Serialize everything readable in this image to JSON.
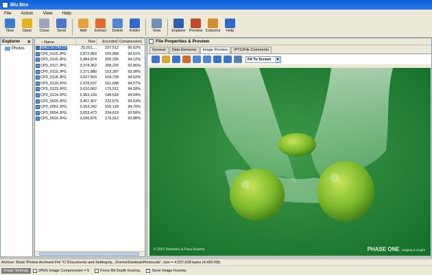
{
  "window": {
    "title": "Blu Box"
  },
  "menu": [
    "File",
    "Action",
    "View",
    "Help"
  ],
  "toolbar": [
    {
      "label": "New",
      "icon": "new-icon",
      "color": "#3a7bd5"
    },
    {
      "label": "Open",
      "icon": "open-icon",
      "color": "#e6b422"
    },
    {
      "label": "Close",
      "icon": "close-icon",
      "color": "#9aa6b8"
    },
    {
      "label": "Send",
      "icon": "send-icon",
      "color": "#4a78c8"
    },
    {
      "label": "Add",
      "icon": "add-icon",
      "color": "#e2a13b"
    },
    {
      "label": "Extract",
      "icon": "extract-icon",
      "color": "#e06b2a"
    },
    {
      "label": "Delete",
      "icon": "delete-icon",
      "color": "#4f84d6"
    },
    {
      "label": "Folder",
      "icon": "folder-icon",
      "color": "#2f69c9"
    },
    {
      "label": "View",
      "icon": "view-icon",
      "color": "#6f8fb8"
    },
    {
      "label": "Explorer",
      "icon": "explorer-icon",
      "color": "#2d5fb0"
    },
    {
      "label": "Preview",
      "icon": "preview-icon",
      "color": "#c04a2b"
    },
    {
      "label": "Columns",
      "icon": "columns-icon",
      "color": "#d88c2a"
    },
    {
      "label": "Help",
      "icon": "help-icon",
      "color": "#2f69c9"
    }
  ],
  "explorer": {
    "title": "Explorer",
    "close": "✕",
    "items": [
      "Photos"
    ]
  },
  "filelist": {
    "columns": [
      "Name",
      "Size",
      "Encoded",
      "Compression"
    ],
    "rows": [
      {
        "name": "WALLIS DM.CF",
        "size": "25,921,...",
        "encoded": "237,512",
        "compression": "95.62%"
      },
      {
        "name": "CP0_0115.JPG",
        "size": "2,872,963",
        "encoded": "155,958",
        "compression": "94.51%"
      },
      {
        "name": "CP0_0116.JPG",
        "size": "3,484,874",
        "encoded": "205,335",
        "compression": "94.12%"
      },
      {
        "name": "CP0_0117.JPG",
        "size": "3,374,362",
        "encoded": "208,226",
        "compression": "93.86%"
      },
      {
        "name": "CP0_0119.JPG",
        "size": "2,271,880",
        "encoded": "153,287",
        "compression": "93.30%"
      },
      {
        "name": "CP0_0118.JPG",
        "size": "3,027,503",
        "encoded": "164,728",
        "compression": "94.52%"
      },
      {
        "name": "CP0_0120.JPG",
        "size": "2,978,537",
        "compression": "94.57%",
        "encoded": "161,648"
      },
      {
        "name": "CP0_0123.JPG",
        "size": "3,010,062",
        "encoded": "175,512",
        "compression": "94.18%"
      },
      {
        "name": "CP0_0124.JPG",
        "size": "2,953,159",
        "encoded": "148,518",
        "compression": "94.94%"
      },
      {
        "name": "CP0_0025.JPG",
        "size": "3,457,407",
        "encoded": "222,575",
        "compression": "93.63%"
      },
      {
        "name": "CP0_0052.JPG",
        "size": "2,053,342",
        "encoded": "150,128",
        "compression": "94.70%"
      },
      {
        "name": "CP0_0054.JPG",
        "size": "3,653,473",
        "encoded": "234,619",
        "compression": "93.58%"
      },
      {
        "name": "CP0_0016.JPG",
        "size": "3,206,876",
        "encoded": "176,912",
        "compression": "93.88%"
      }
    ]
  },
  "props": {
    "title": "File Properties & Preview",
    "tabs": [
      "General",
      "Data Elements",
      "Image Preview",
      "IPTC/File Comments"
    ],
    "active_tab": 2,
    "fit_mode": "Fit To Screen",
    "image_copyright": "© 2002 Riebeeks & Paca Nuxima",
    "image_brand": "PHASE ONE",
    "image_brand_small": "imaging & insight"
  },
  "status": {
    "text": "Archive: Basic Photos Archived File \"C:\\Documents and Settings\\p...\\Forms\\Desktop\\Photos.bb\", size = 4,537,618 bytes (4,430 KB)"
  },
  "bottombar": {
    "label": "Image Settings",
    "items": [
      "JPEG Image Compression = 5",
      "Force Bit Depth Incomp.",
      "Store Image Incomp."
    ]
  }
}
